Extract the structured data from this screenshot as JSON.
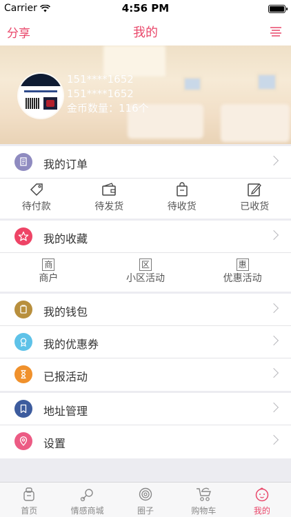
{
  "status_bar": {
    "carrier": "Carrier",
    "time": "4:56 PM"
  },
  "nav": {
    "share": "分享",
    "title": "我的",
    "menu_icon": "menu-icon"
  },
  "profile": {
    "line1": "151****1652",
    "line2": "151****1652",
    "coins": "金币数量：116个"
  },
  "orders": {
    "label": "我的订单",
    "items": [
      {
        "label": "待付款",
        "icon": "tag-icon"
      },
      {
        "label": "待发货",
        "icon": "wallet-icon"
      },
      {
        "label": "待收货",
        "icon": "bag-icon"
      },
      {
        "label": "已收货",
        "icon": "edit-icon"
      }
    ]
  },
  "favorites": {
    "label": "我的收藏",
    "items": [
      {
        "label": "商户",
        "char": "商"
      },
      {
        "label": "小区活动",
        "char": "区"
      },
      {
        "label": "优惠活动",
        "char": "惠"
      }
    ]
  },
  "menu": {
    "wallet": "我的钱包",
    "coupons": "我的优惠券",
    "activities": "已报活动",
    "address": "地址管理",
    "settings": "设置"
  },
  "colors": {
    "accent": "#e9476a",
    "orders_icon": "#8f8bc0",
    "favorites_icon": "#ee4466",
    "wallet_icon": "#b88f3d",
    "coupons_icon": "#5ec2e8",
    "activities_icon": "#f0912c",
    "address_icon": "#3d5c9e",
    "settings_icon": "#ec5b84"
  },
  "tabbar": [
    {
      "label": "首页",
      "icon": "home-icon",
      "active": false
    },
    {
      "label": "情感商城",
      "icon": "pacifier-icon",
      "active": false
    },
    {
      "label": "圈子",
      "icon": "circle-icon",
      "active": false
    },
    {
      "label": "购物车",
      "icon": "stroller-icon",
      "active": false
    },
    {
      "label": "我的",
      "icon": "baby-face-icon",
      "active": true
    }
  ]
}
